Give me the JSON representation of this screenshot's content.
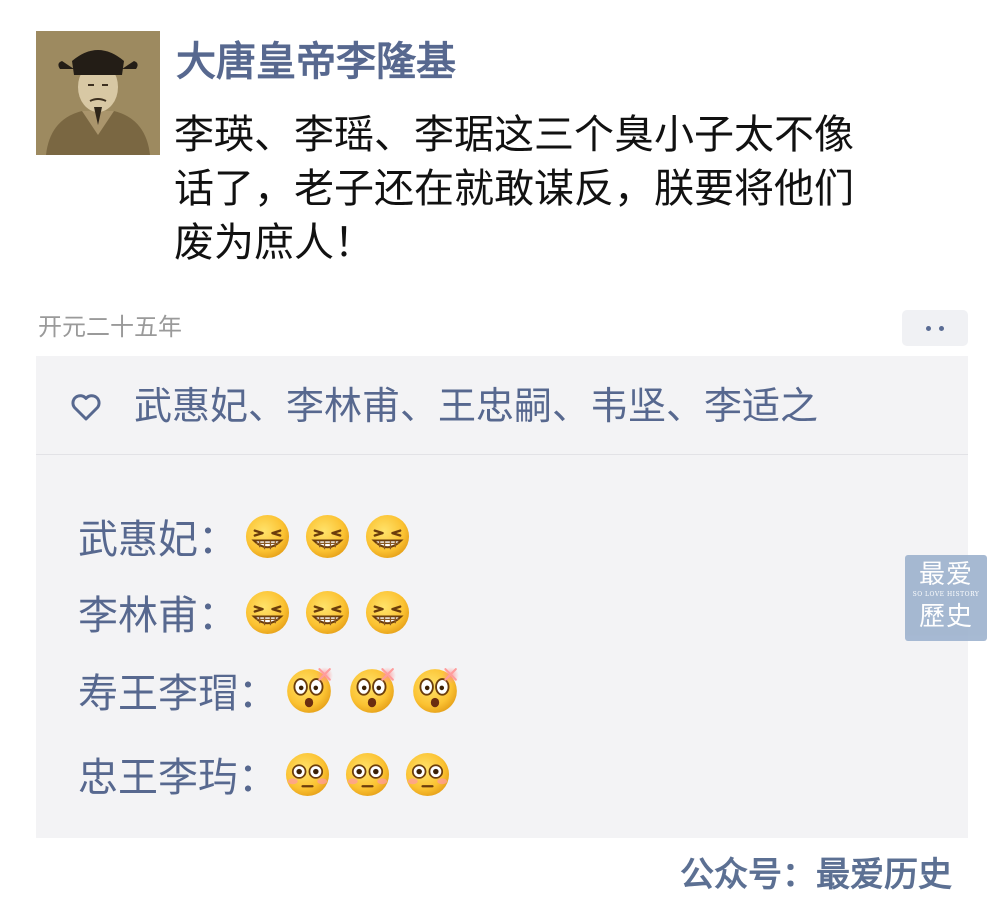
{
  "post": {
    "author": "大唐皇帝李隆基",
    "text_lines": [
      "李瑛、李瑶、李琚这三个臭小子太不像",
      "话了，老子还在就敢谋反，朕要将他们",
      "废为庶人！"
    ],
    "timestamp": "开元二十五年",
    "avatar_icon": "portrait-icon"
  },
  "likes": {
    "icon": "heart-icon",
    "names": "武惠妃、李林甫、王忠嗣、韦坚、李适之"
  },
  "comments": [
    {
      "author": "武惠妃",
      "separator": "：",
      "emoji": "grin-emoji",
      "count": 3
    },
    {
      "author": "李林甫",
      "separator": "：",
      "emoji": "grin-emoji",
      "count": 3
    },
    {
      "author": "寿王李瑁",
      "separator": "：",
      "emoji": "shocked-emoji",
      "count": 3
    },
    {
      "author": "忠王李玙",
      "separator": "：",
      "emoji": "flushed-emoji",
      "count": 3
    }
  ],
  "watermark": {
    "top": "最爱",
    "middle": "SO LOVE HISTORY",
    "bottom": "歷史"
  },
  "footer": "公众号：最爱历史",
  "colors": {
    "name_link": "#57688f",
    "panel_bg": "#f3f3f5",
    "timestamp": "#9a9a9a"
  }
}
